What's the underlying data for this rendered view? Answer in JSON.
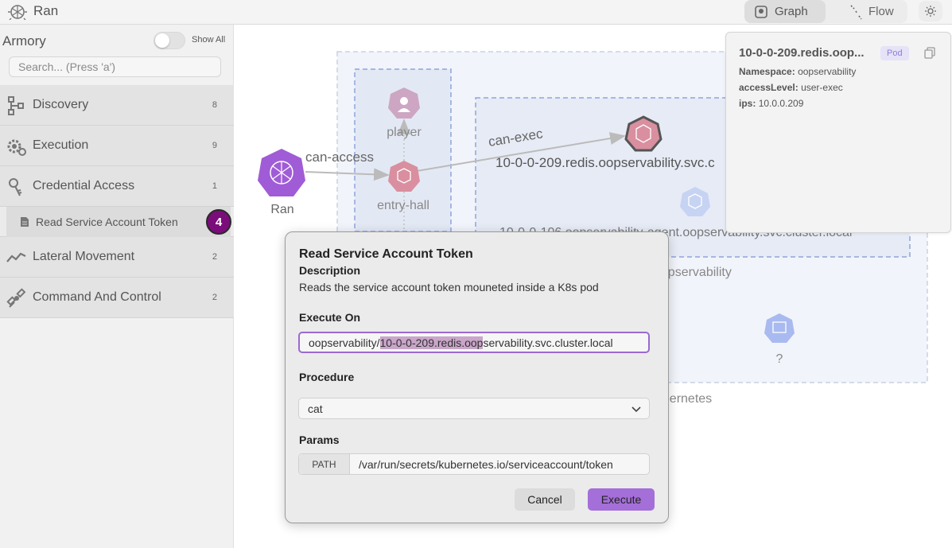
{
  "app": {
    "title": "Ran"
  },
  "view_switch": {
    "graph_label": "Graph",
    "flow_label": "Flow",
    "active": "Graph"
  },
  "sidebar": {
    "title": "Armory",
    "show_all_label": "Show All",
    "show_all_on": false,
    "search_placeholder": "Search... (Press 'a')",
    "categories": [
      {
        "label": "Discovery",
        "count": "8",
        "icon": "discovery-icon"
      },
      {
        "label": "Execution",
        "count": "9",
        "icon": "execution-gear-icon"
      },
      {
        "label": "Credential Access",
        "count": "1",
        "icon": "credential-key-icon"
      },
      {
        "label": "Lateral Movement",
        "count": "2",
        "icon": "lateral-movement-icon"
      },
      {
        "label": "Command And Control",
        "count": "2",
        "icon": "satellite-icon"
      }
    ],
    "selected_technique": {
      "label": "Read Service Account Token",
      "badge": "4",
      "icon": "document-icon"
    }
  },
  "graph": {
    "nodes": {
      "ran": "Ran",
      "player": "player",
      "entry_hall": "entry-hall",
      "redis": "10-0-0-209.redis.oopservability.svc.c",
      "agent": "10-0-0-106.oopservability-agent.oopservability.svc.cluster.local",
      "unknown": "?"
    },
    "edges": {
      "can_access": "can-access",
      "can_exec": "can-exec"
    },
    "groups": {
      "namespace": "oopservability",
      "cluster": "kubernetes"
    }
  },
  "info_card": {
    "title": "10-0-0-209.redis.oop...",
    "badge": "Pod",
    "namespace_label": "Namespace:",
    "namespace_value": "oopservability",
    "access_label": "accessLevel:",
    "access_value": "user-exec",
    "ips_label": "ips:",
    "ips_value": "10.0.0.209"
  },
  "modal": {
    "title": "Read Service Account Token",
    "description_label": "Description",
    "description": "Reads the service account token mouneted inside a K8s pod",
    "execute_on_label": "Execute On",
    "execute_on_prefix": "oopservability/",
    "execute_on_highlight": "10-0-0-209.redis.oop",
    "execute_on_suffix": "servability.svc.cluster.local",
    "procedure_label": "Procedure",
    "procedure_value": "cat",
    "params_label": "Params",
    "param_key": "PATH",
    "param_value": "/var/run/secrets/kubernetes.io/serviceaccount/token",
    "cancel_label": "Cancel",
    "execute_label": "Execute"
  },
  "colors": {
    "accent": "#a46fd8",
    "badge": "#7a0d7a",
    "pod_node": "#d98f9f",
    "ran_node": "#a05cd6"
  }
}
